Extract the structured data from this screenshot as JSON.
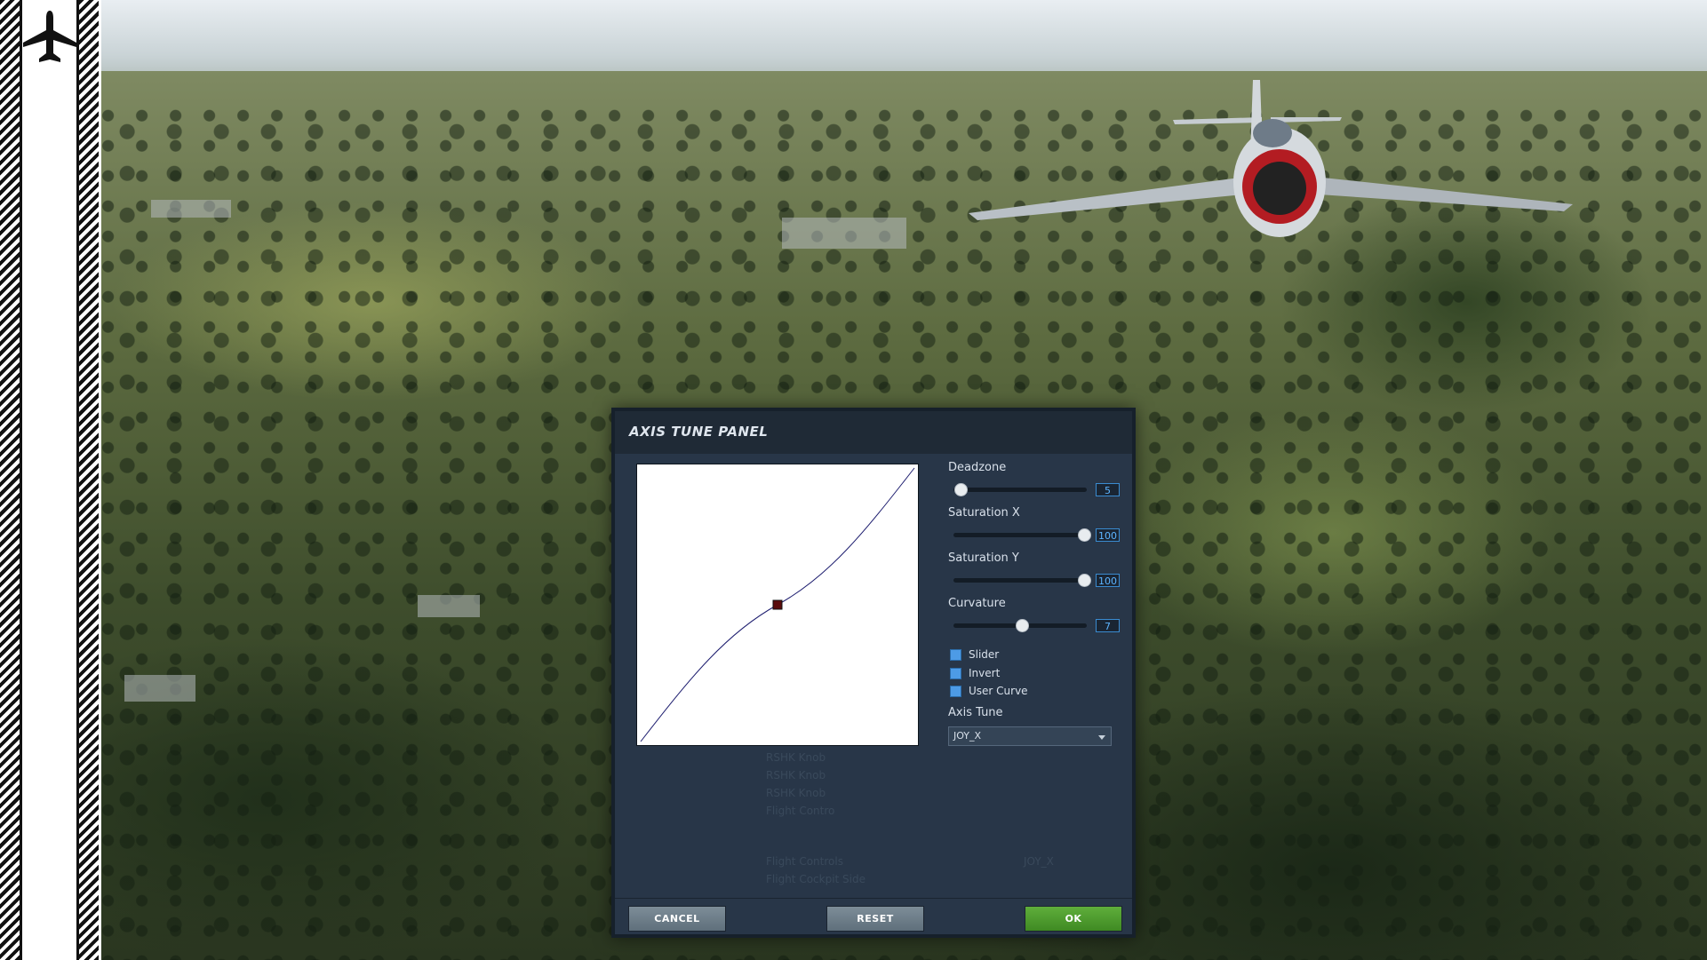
{
  "sidebar": {
    "icon": "airplane-icon"
  },
  "dialog": {
    "title": "AXIS TUNE PANEL",
    "curve": {
      "center_point_icon": "curve-control-point-icon"
    },
    "deadzone": {
      "label": "Deadzone",
      "value": "5",
      "fraction": 0.05
    },
    "saturation_x": {
      "label": "Saturation X",
      "value": "100",
      "fraction": 1.0
    },
    "saturation_y": {
      "label": "Saturation Y",
      "value": "100",
      "fraction": 1.0
    },
    "curvature": {
      "label": "Curvature",
      "value": "7",
      "fraction": 0.55
    },
    "checkboxes": [
      {
        "label": "Slider"
      },
      {
        "label": "Invert"
      },
      {
        "label": "User Curve"
      }
    ],
    "axis_tune": {
      "label": "Axis Tune",
      "selected": "JOY_X"
    },
    "buttons": {
      "cancel": "CANCEL",
      "reset": "RESET",
      "ok": "OK"
    },
    "background_ghost_text": [
      "RSHK Knob",
      "RSHK Knob",
      "RSHK Knob",
      "Flight Contro",
      "Flight Controls",
      "Flight Cockpit Side",
      "JOY_X"
    ]
  },
  "colors": {
    "ok_button": "#4f9e2f",
    "grey_button": "#6e7e8a",
    "value_text": "#5db4ff",
    "checkbox": "#4d9be6",
    "dialog_bg": "#283648"
  }
}
